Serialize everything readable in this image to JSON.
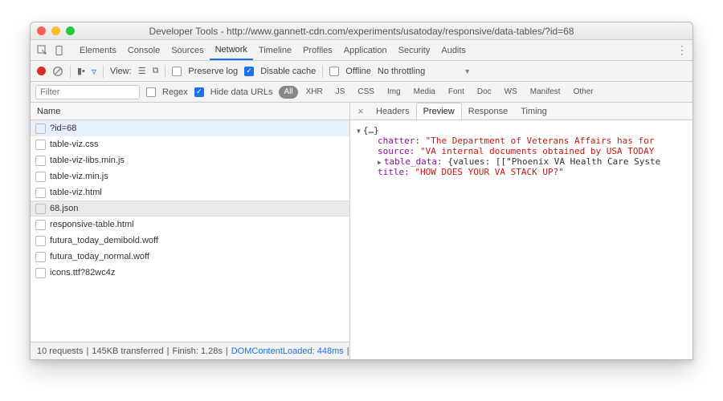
{
  "window": {
    "title": "Developer Tools - http://www.gannett-cdn.com/experiments/usatoday/responsive/data-tables/?id=68"
  },
  "main_tabs": {
    "items": [
      "Elements",
      "Console",
      "Sources",
      "Network",
      "Timeline",
      "Profiles",
      "Application",
      "Security",
      "Audits"
    ],
    "active": "Network"
  },
  "toolbar": {
    "view_label": "View:",
    "preserve_log": "Preserve log",
    "disable_cache": "Disable cache",
    "offline": "Offline",
    "throttling": "No throttling"
  },
  "filter": {
    "placeholder": "Filter",
    "regex": "Regex",
    "hide_data_urls": "Hide data URLs",
    "types": [
      "All",
      "XHR",
      "JS",
      "CSS",
      "Img",
      "Media",
      "Font",
      "Doc",
      "WS",
      "Manifest",
      "Other"
    ]
  },
  "name_header": "Name",
  "requests": [
    {
      "name": "?id=68",
      "selected": true
    },
    {
      "name": "table-viz.css"
    },
    {
      "name": "table-viz-libs.min.js"
    },
    {
      "name": "table-viz.min.js"
    },
    {
      "name": "table-viz.html"
    },
    {
      "name": "68.json",
      "active": true
    },
    {
      "name": "responsive-table.html"
    },
    {
      "name": "futura_today_demibold.woff"
    },
    {
      "name": "futura_today_normal.woff"
    },
    {
      "name": "icons.ttf?82wc4z"
    }
  ],
  "status": {
    "requests": "10 requests",
    "transferred": "145KB transferred",
    "finish": "Finish: 1.28s",
    "dcl": "DOMContentLoaded: 448ms",
    "tail": "| …"
  },
  "detail_tabs": {
    "items": [
      "Headers",
      "Preview",
      "Response",
      "Timing"
    ],
    "active": "Preview"
  },
  "preview": {
    "root": "{…}",
    "chatter_key": "chatter:",
    "chatter_val": "\"The Department of Veterans Affairs has for",
    "source_key": "source:",
    "source_val": "\"VA internal documents obtained by USA TODAY",
    "table_key": "table_data:",
    "table_val": "{values: [[\"Phoenix VA Health Care Syste",
    "title_key": "title:",
    "title_val": "\"HOW DOES YOUR VA STACK UP?\""
  }
}
